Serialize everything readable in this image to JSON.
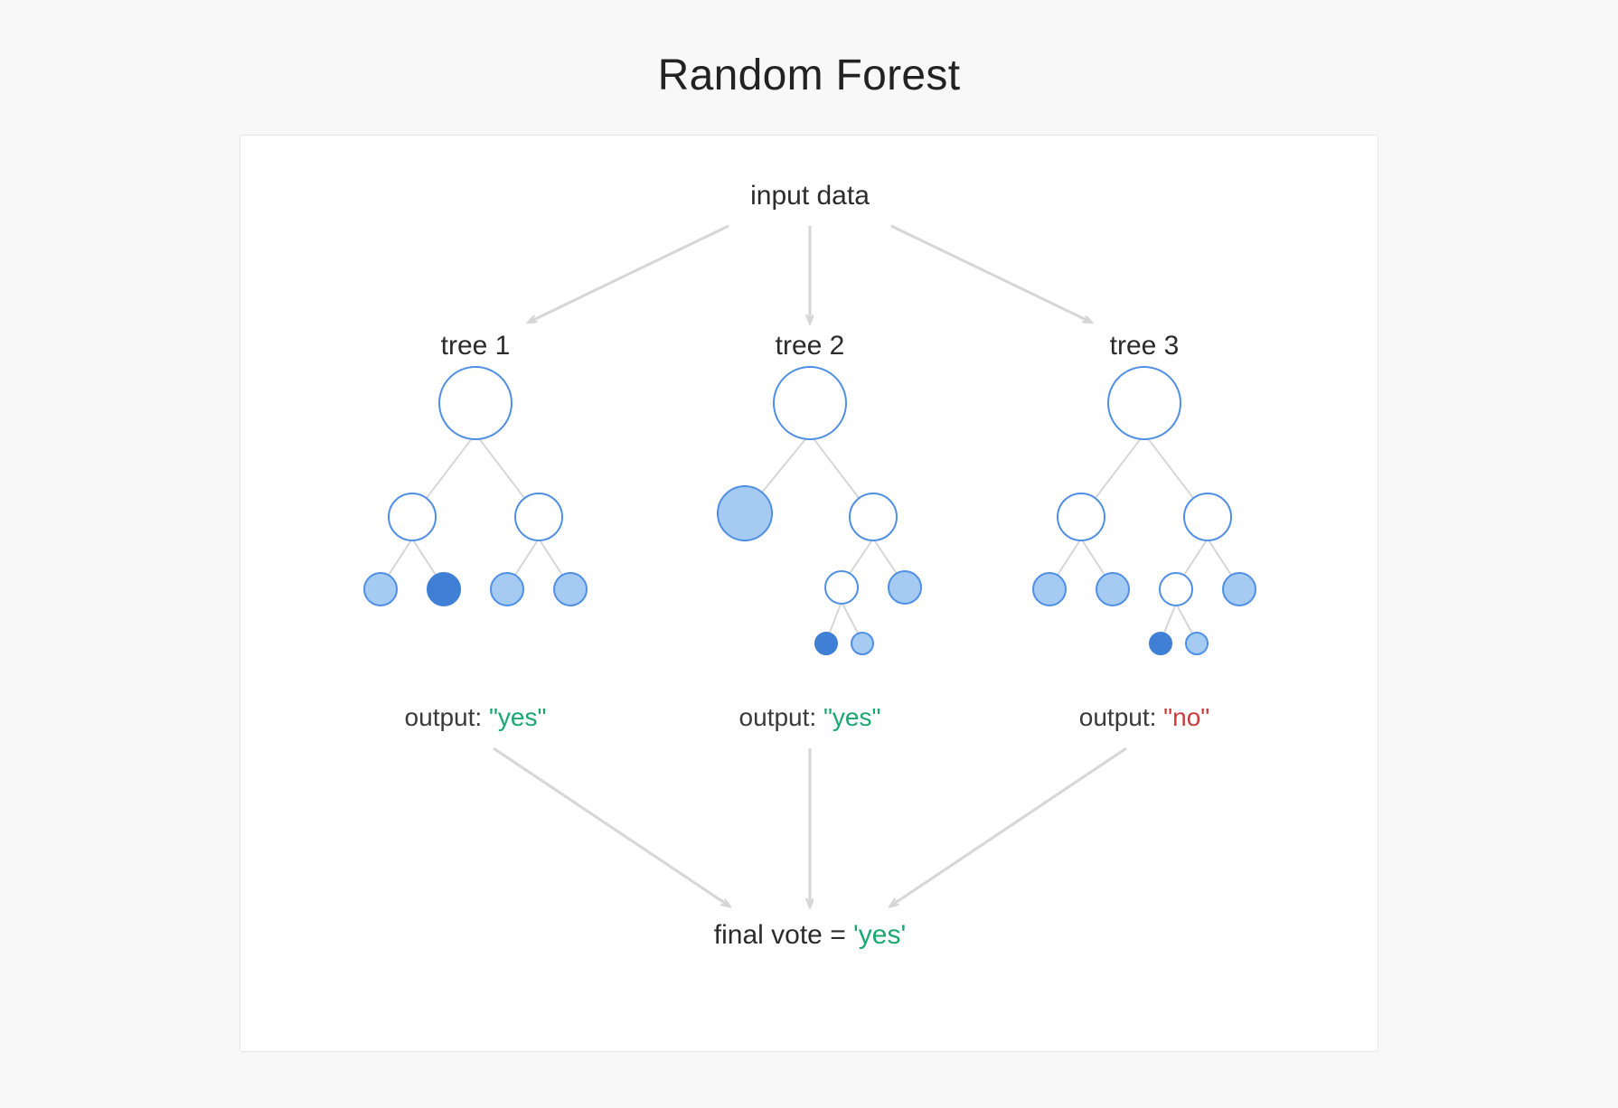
{
  "title": "Random Forest",
  "input_label": "input data",
  "output_prefix": "output: ",
  "trees": [
    {
      "name": "tree 1",
      "output": "yes",
      "output_kind": "yes"
    },
    {
      "name": "tree 2",
      "output": "yes",
      "output_kind": "yes"
    },
    {
      "name": "tree 3",
      "output": "no",
      "output_kind": "no"
    }
  ],
  "final": {
    "prefix": "final vote = ",
    "value": "yes",
    "kind": "yes"
  },
  "colors": {
    "page_bg": "#f8f8f8",
    "panel_bg": "#ffffff",
    "panel_border": "#e7e7e7",
    "text": "#222222",
    "arrow": "#d6d6d6",
    "node_stroke": "#4f8fe6",
    "node_fill_light": "#a5cbf2",
    "node_fill_dark": "#3f7fd6",
    "yes": "#1aa870",
    "no": "#c83c3c"
  }
}
